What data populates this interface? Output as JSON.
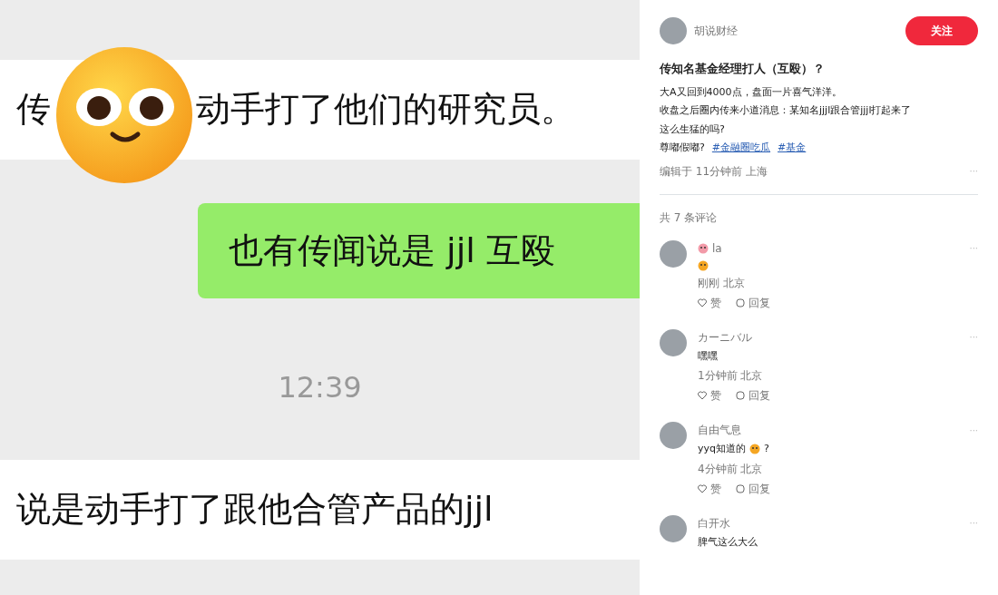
{
  "chat": {
    "messages": [
      {
        "kind": "received",
        "parts": [
          "传",
          "动手打了他们的研究员。"
        ],
        "sticker": true
      },
      {
        "kind": "sent",
        "parts": [
          "也有传闻说是 jjl 互殴"
        ],
        "sticker": false
      },
      {
        "kind": "time",
        "parts": [
          "12:39"
        ],
        "sticker": false
      },
      {
        "kind": "received",
        "parts": [
          "说是动手打了跟他合管产品的jjl"
        ],
        "sticker": false
      }
    ]
  },
  "post": {
    "author": "胡说财经",
    "follow_button": "关注",
    "title": "传知名基金经理打人（互殴）？",
    "body": [
      "大A又回到4000点，盘面一片喜气洋洋。",
      "收盘之后圈内传来小道消息：某知名jjjl跟合管jjjl打起来了",
      "这么生猛的吗?"
    ],
    "tag_line": "尊嘟假嘟?",
    "tags": [
      "#金融圈吃瓜",
      "#基金"
    ],
    "meta": "编辑于 11分钟前 上海",
    "more": "···",
    "comment_count": "共 7 条评论",
    "comments": [
      {
        "name": "la",
        "name_emoji": true,
        "emoji": true,
        "more": "···",
        "meta": "刚刚 北京",
        "like": "赞",
        "reply": "回复"
      },
      {
        "name": "カーニバル",
        "name_emoji": false,
        "text": "嘿嘿",
        "emoji": false,
        "more": "···",
        "meta": "1分钟前 北京",
        "like": "赞",
        "reply": "回复"
      },
      {
        "name": "自由气息",
        "name_emoji": false,
        "text": "yyq知道的",
        "emoji": true,
        "tail": "?",
        "more": "···",
        "meta": "4分钟前 北京",
        "like": "赞",
        "reply": "回复"
      },
      {
        "name": "白开水",
        "name_emoji": false,
        "text": "脾气这么大么",
        "emoji": false,
        "more": "···"
      }
    ]
  }
}
